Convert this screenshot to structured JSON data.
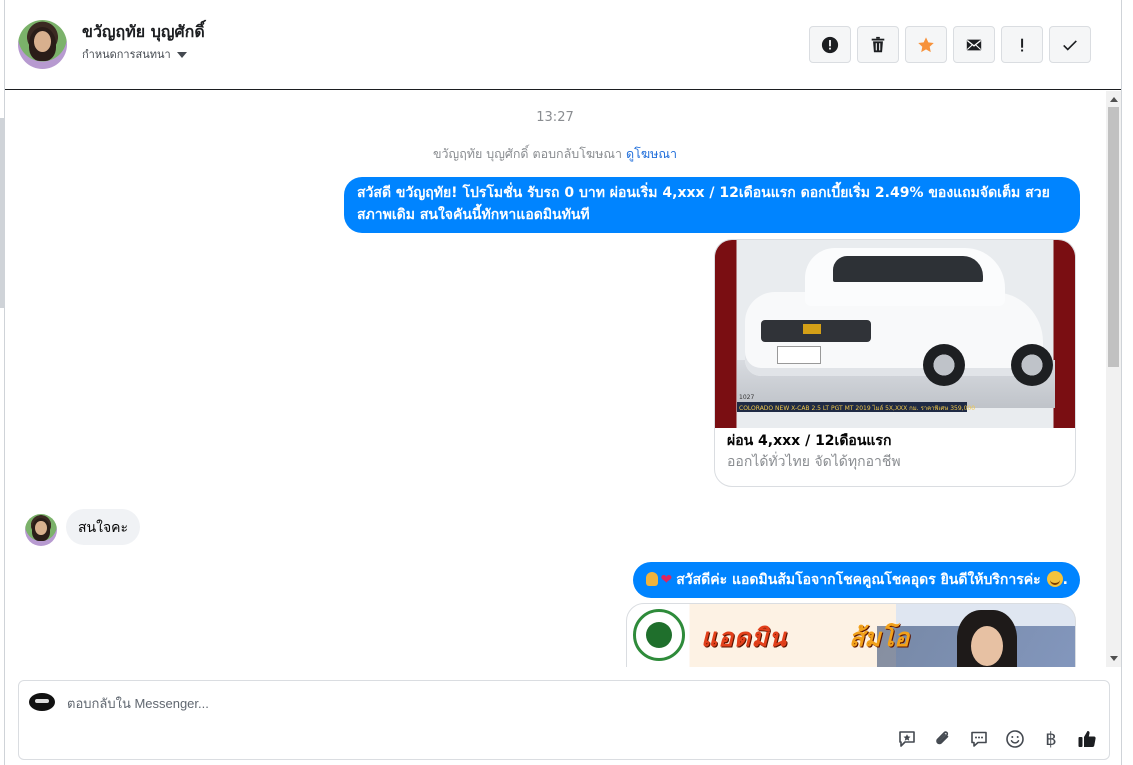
{
  "header": {
    "contact_name": "ขวัญฤทัย บุญศักดิ์",
    "assign_label": "กำหนดการสนทนา",
    "actions": [
      {
        "name": "spam-icon",
        "label": "!"
      },
      {
        "name": "trash-icon",
        "label": ""
      },
      {
        "name": "star-icon",
        "label": ""
      },
      {
        "name": "envelope-icon",
        "label": ""
      },
      {
        "name": "exclamation-icon",
        "label": "!"
      },
      {
        "name": "check-icon",
        "label": ""
      }
    ]
  },
  "conversation": {
    "timestamp": "13:27",
    "ad_reply_prefix": "ขวัญฤทัย บุญศักดิ์ ตอบกลับโฆษณา",
    "ad_reply_link": "ดูโฆษณา",
    "messages": [
      {
        "direction": "out",
        "text": "สวัสดี ขวัญฤทัย! โปรโมชั่น รับรถ 0 บาท ผ่อนเริ่ม 4,xxx / 12เดือนแรก ดอกเบี้ยเริ่ม 2.49% ของแถมจัดเต็ม สวยสภาพเดิม สนใจคันนี้ทักหาแอดมินทันที"
      },
      {
        "direction": "in",
        "text": "สนใจคะ"
      },
      {
        "direction": "out",
        "text": "สวัสดีค่ะ แอดมินส้มโอจากโชคคูณโชคอุดร ยินดีให้บริการค่ะ"
      }
    ],
    "card": {
      "title": "ผ่อน 4,xxx / 12เดือนแรก",
      "subtitle": "ออกได้ทั่วไทย จัดได้ทุกอาชีพ",
      "image_strip_text": "COLORADO NEW X-CAB 2.5 LT PGT MT 2019 ไมล์ 5X,XXX กม. ราคาพิเศษ 359,000",
      "image_code": "1027"
    },
    "promo_image": {
      "text1": "แอดมิน",
      "text2": "ส้มโอ"
    }
  },
  "composer": {
    "placeholder": "ตอบกลับใน Messenger...",
    "tools": [
      "saved-reply-icon",
      "attachment-icon",
      "chat-bubble-icon",
      "emoji-icon",
      "baht-icon",
      "thumbs-up-icon"
    ],
    "baht_symbol": "฿"
  },
  "colors": {
    "outgoing_bubble": "#0084ff",
    "incoming_bubble": "#f0f2f5",
    "star_accent": "#f7923b"
  }
}
